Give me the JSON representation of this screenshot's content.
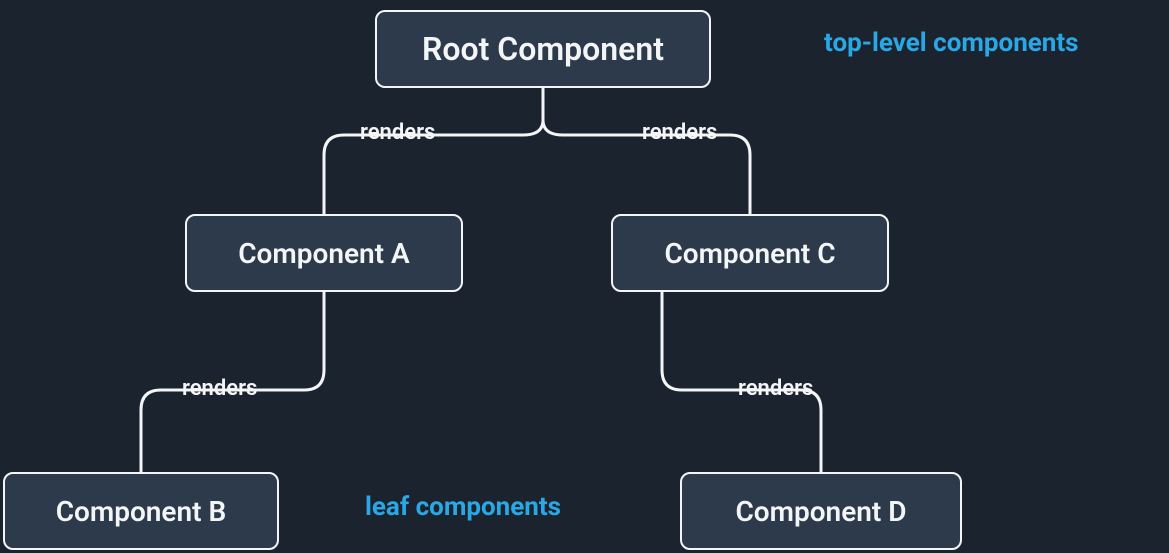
{
  "nodes": {
    "root": {
      "label": "Root Component"
    },
    "compA": {
      "label": "Component A"
    },
    "compB": {
      "label": "Component B"
    },
    "compC": {
      "label": "Component C"
    },
    "compD": {
      "label": "Component D"
    }
  },
  "edges": {
    "root_to_A": {
      "label": "renders"
    },
    "root_to_C": {
      "label": "renders"
    },
    "A_to_B": {
      "label": "renders"
    },
    "C_to_D": {
      "label": "renders"
    }
  },
  "annotations": {
    "top": "top-level components",
    "leaf": "leaf components"
  },
  "colors": {
    "node_bg": "#2c3a4b",
    "node_border": "#f4f5f6",
    "node_text": "#f4f5f6",
    "edge": "#f4f5f6",
    "annotation": "#2aa8e6",
    "background": "#1b242e"
  }
}
